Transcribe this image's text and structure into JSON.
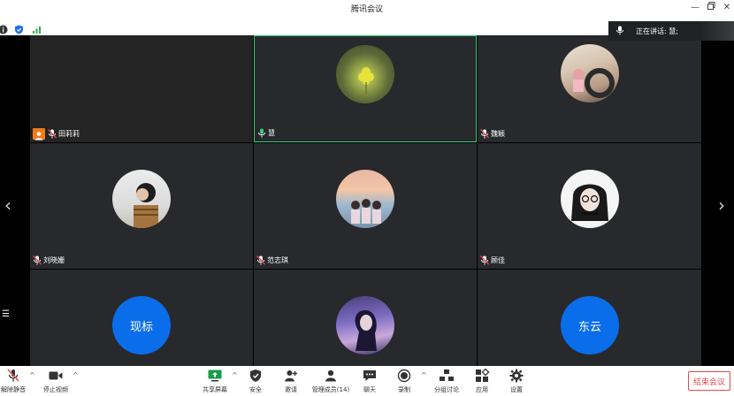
{
  "window": {
    "title": "腾讯会议"
  },
  "speaking": {
    "label": "正在讲话: 慧;"
  },
  "participants": [
    {
      "name": "田莉莉",
      "host": true
    },
    {
      "name": "慧",
      "active": true
    },
    {
      "name": "魏颖"
    },
    {
      "name": "刘晓姗"
    },
    {
      "name": "范志琪"
    },
    {
      "name": "顾佳"
    },
    {
      "name": "",
      "avatar_text": "现标"
    },
    {
      "name": ""
    },
    {
      "name": "",
      "avatar_text": "东云"
    }
  ],
  "toolbar": {
    "unmute": "解除静音",
    "stop_video": "停止视频",
    "share_screen": "共享屏幕",
    "security": "安全",
    "invite": "邀请",
    "manage_members": "管理成员(14)",
    "chat": "聊天",
    "record": "录制",
    "breakout": "分组讨论",
    "apps": "应用",
    "settings": "设置",
    "end_meeting": "结束会议"
  },
  "colors": {
    "accent": "#0a6eea",
    "active_border": "#2fd07a",
    "host_badge": "#ef7b1b",
    "danger": "#e34b4b"
  }
}
